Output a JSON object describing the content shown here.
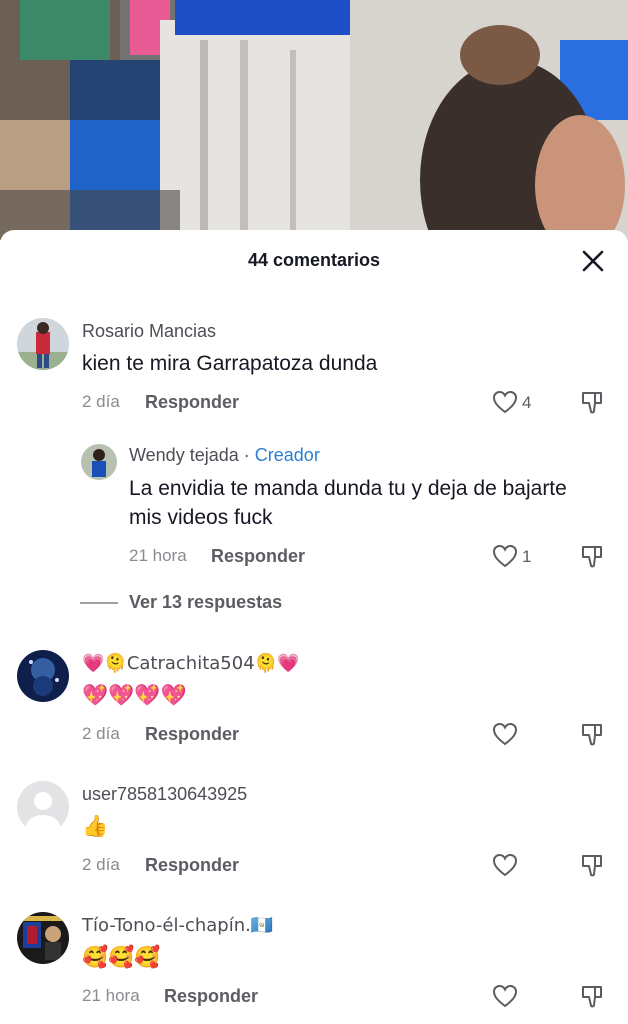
{
  "video": {
    "description_icon": "video-frame"
  },
  "sheet": {
    "title": "44 comentarios"
  },
  "comments": [
    {
      "user": "Rosario Mancias",
      "text": "kien te mira Garrapatoza dunda",
      "time": "2 día",
      "reply": "Responder",
      "likes": "4"
    },
    {
      "user": "Wendy tejada",
      "badge_sep": "·",
      "badge": "Creador",
      "text_line1": "La envidia te manda dunda tu y deja de bajarte",
      "text_line2": "mis videos fuck",
      "time": "21 hora",
      "reply": "Responder",
      "likes": "1"
    },
    {
      "view_replies": "Ver 13 respuestas"
    },
    {
      "user": "💗🫠Catrachita504🫠💗",
      "text": "💖💖💖💖",
      "time": "2 día",
      "reply": "Responder"
    },
    {
      "user": "user7858130643925",
      "text": "👍",
      "time": "2 día",
      "reply": "Responder"
    },
    {
      "user": "Tío-Tono-él-chapín.🇬🇹",
      "text": "🥰🥰🥰",
      "time": "21 hora",
      "reply": "Responder"
    }
  ],
  "colors": {
    "creator_badge": "#2a7fd4",
    "muted": "#8a8b91",
    "text": "#161823"
  }
}
